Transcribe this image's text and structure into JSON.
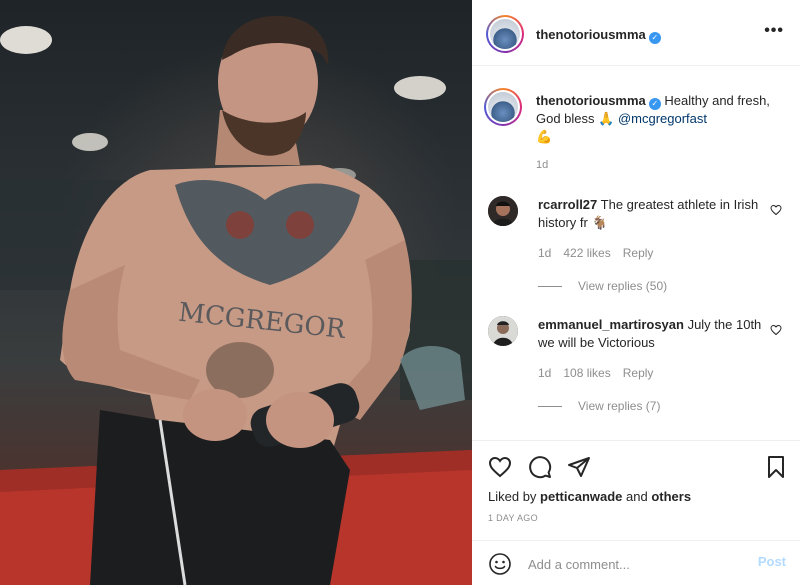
{
  "post": {
    "author": "thenotoriousmma",
    "verified": true,
    "image_description_icon": "photo"
  },
  "caption": {
    "username": "thenotoriousmma",
    "text": " Healthy and fresh, God bless 🙏 ",
    "mention": "@mcgregorfast",
    "emoji": "💪",
    "age": "1d"
  },
  "comments": [
    {
      "username": "rcarroll27",
      "text": " The greatest athlete in Irish history fr 🐐",
      "age": "1d",
      "likes": "422 likes",
      "reply_label": "Reply",
      "view_replies": "View replies (50)"
    },
    {
      "username": "emmanuel_martirosyan",
      "text": " July the 10th we will be Victorious",
      "age": "1d",
      "likes": "108 likes",
      "reply_label": "Reply",
      "view_replies": "View replies (7)"
    }
  ],
  "actions": {
    "liked_by_prefix": "Liked by ",
    "liked_by_user": "petticanwade",
    "liked_by_suffix": " and ",
    "liked_by_others": "others",
    "date": "1 DAY AGO"
  },
  "add_comment": {
    "placeholder": "Add a comment...",
    "post_label": "Post"
  },
  "colors": {
    "verified": "#3897f0",
    "mention": "#00376b",
    "muted": "#8e8e8e",
    "post_disabled": "#b3dbff"
  }
}
